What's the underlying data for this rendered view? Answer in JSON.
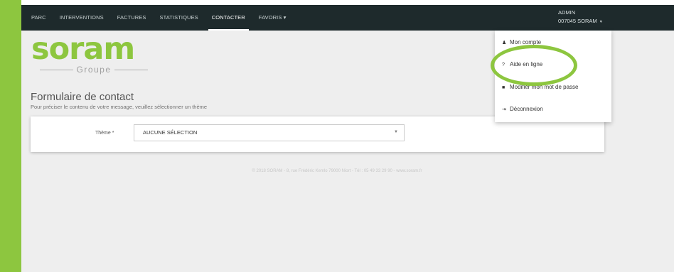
{
  "nav": {
    "items": [
      {
        "label": "PARC",
        "active": false
      },
      {
        "label": "INTERVENTIONS",
        "active": false
      },
      {
        "label": "FACTURES",
        "active": false
      },
      {
        "label": "STATISTIQUES",
        "active": false
      },
      {
        "label": "CONTACTER",
        "active": true
      },
      {
        "label": "FAVORIS ▾",
        "active": false
      }
    ],
    "user": {
      "role": "ADMIN",
      "account": "007045 SORAM",
      "caret": "▾"
    }
  },
  "logo": {
    "brand": "soram",
    "subtitle": "Groupe"
  },
  "form": {
    "title": "Formulaire de contact",
    "subtitle": "Pour préciser le contenu de votre message, veuillez sélectionner un thème",
    "theme_label": "Thème *",
    "theme_value": "AUCUNE SÉLECTION",
    "select_arrow": "▼"
  },
  "footer": {
    "text": "© 2018 SORAM - 8, rue Frédéric Kemlo 79000 Niort - Tél : 05 49 33 29 90 - www.soram.fr"
  },
  "dropdown": {
    "items": [
      {
        "icon": "user-icon",
        "glyph": "♟",
        "label": "Mon compte"
      },
      {
        "icon": "question-icon",
        "glyph": "?",
        "label": "Aide en ligne"
      },
      {
        "icon": "lock-icon",
        "glyph": "■",
        "label": "Modifier mon mot de passe"
      },
      {
        "icon": "sign-out-icon",
        "glyph": "⇥",
        "label": "Déconnexion"
      }
    ]
  },
  "colors": {
    "brand_green": "#8dc63f",
    "navbar": "#1e2a2c",
    "background": "#eeeeee"
  }
}
